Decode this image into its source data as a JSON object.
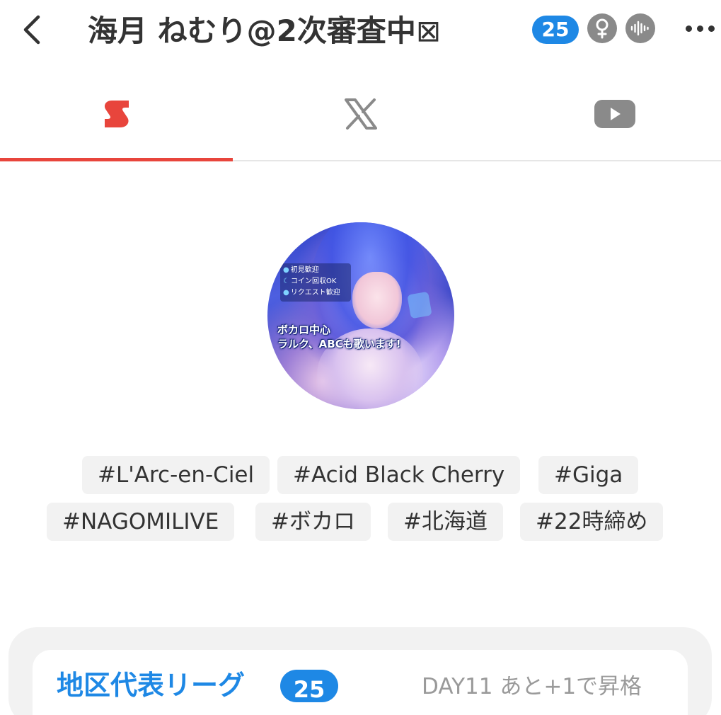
{
  "header": {
    "title": "海月 ねむり@2次審査中",
    "title_suffix_glyph": "⊠",
    "level_badge": "25",
    "back_icon": "chevron-left-icon",
    "gender_icon": "female-icon",
    "voice_icon": "voice-waveform-icon",
    "more_icon": "more-dots-icon"
  },
  "tabs": [
    {
      "name": "17live",
      "icon": "seventeen-live-icon",
      "active": true,
      "color": "#e8453c"
    },
    {
      "name": "x",
      "icon": "x-logo-icon",
      "active": false,
      "color": "#8a8a8a"
    },
    {
      "name": "youtube",
      "icon": "youtube-icon",
      "active": false,
      "color": "#8a8a8a"
    }
  ],
  "avatar": {
    "info_lines": [
      "初見歓迎",
      "コイン回収OK",
      "リクエスト歓迎"
    ],
    "caption_line1": "ボカロ中心",
    "caption_line2": "ラルク、ABCも歌います!"
  },
  "tags": [
    "#L'Arc-en-Ciel",
    "#Acid Black Cherry",
    "#Giga",
    "#NAGOMILIVE",
    "#ボカロ",
    "#北海道",
    "#22時締め"
  ],
  "league": {
    "title": "地区代表リーグ",
    "badge": "25",
    "status": "DAY11 あと+1で昇格"
  },
  "colors": {
    "accent_red": "#e8453c",
    "accent_blue": "#1e88e5",
    "text_dark": "#333333",
    "text_muted": "#9a9a9a",
    "tag_bg": "#f2f2f2"
  }
}
